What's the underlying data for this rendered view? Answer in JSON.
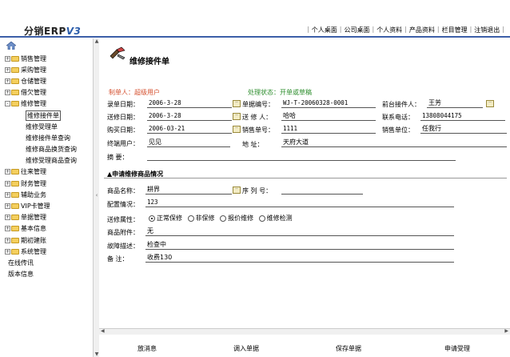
{
  "header": {
    "logo_text": "分销ERP",
    "logo_version": "V3",
    "nav": [
      "个人桌面",
      "公司桌面",
      "个人资料",
      "产品资料",
      "栏目管理",
      "注销退出"
    ]
  },
  "sidebar": {
    "items": [
      {
        "type": "folder",
        "label": "销售管理",
        "state": "+"
      },
      {
        "type": "folder",
        "label": "采购管理",
        "state": "+"
      },
      {
        "type": "folder",
        "label": "仓储管理",
        "state": "+"
      },
      {
        "type": "folder",
        "label": "借欠管理",
        "state": "+"
      },
      {
        "type": "folder",
        "label": "维修管理",
        "state": "-"
      },
      {
        "type": "child",
        "label": "维修接件单",
        "selected": true
      },
      {
        "type": "child",
        "label": "维修受理单"
      },
      {
        "type": "child",
        "label": "维修接件单查询"
      },
      {
        "type": "child",
        "label": "维修商品换货查询"
      },
      {
        "type": "child",
        "label": "维修受理商品查询"
      },
      {
        "type": "folder",
        "label": "往来管理",
        "state": "+"
      },
      {
        "type": "folder",
        "label": "财务管理",
        "state": "+"
      },
      {
        "type": "folder",
        "label": "辅助业务",
        "state": "+"
      },
      {
        "type": "folder",
        "label": "VIP卡管理",
        "state": "+"
      },
      {
        "type": "folder",
        "label": "单据管理",
        "state": "+"
      },
      {
        "type": "folder",
        "label": "基本信息",
        "state": "+"
      },
      {
        "type": "folder",
        "label": "期初建账",
        "state": "+"
      },
      {
        "type": "folder",
        "label": "系统管理",
        "state": "+"
      },
      {
        "type": "leaf",
        "label": "在线传讯"
      },
      {
        "type": "leaf",
        "label": "版本信息"
      }
    ]
  },
  "form": {
    "title": "维修接件单",
    "creator": "制单人：超级用户",
    "status": "处理状态：开单或草稿",
    "labels": {
      "record_date": "录单日期：",
      "bill_no": "单据编号：",
      "front_staff": "前台接件人：",
      "send_date": "送修日期：",
      "sender": "送 修 人：",
      "phone": "联系电话：",
      "buy_date": "购买日期：",
      "sales_no": "销售单号：",
      "sales_unit": "销售单位：",
      "end_user": "终端用户：",
      "address": "地    址：",
      "summary": "摘    要："
    },
    "values": {
      "record_date": "2006-3-28",
      "bill_no": "WJ-T-20060328-0001",
      "front_staff": "王芳",
      "send_date": "2006-3-28",
      "sender": "哈哈",
      "phone": "13808044175",
      "buy_date": "2006-03-21",
      "sales_no": "1111",
      "sales_unit": "任我行",
      "end_user": "见见",
      "address": "天府大道",
      "summary": ""
    },
    "section_title": "▲申请维修商品情况",
    "goods": {
      "labels": {
        "name": "商品名称：",
        "serial": "序 列 号：",
        "config": "配置情况：",
        "repair_type": "送修属性：",
        "accessory": "商品附件：",
        "fault": "故障描述：",
        "remark": "备    注："
      },
      "values": {
        "name": "耕界",
        "serial": "",
        "config": "123",
        "accessory": "无",
        "fault": "检查中",
        "remark": "收费130"
      },
      "repair_options": [
        {
          "label": "正常保修",
          "checked": true
        },
        {
          "label": "非保修",
          "checked": false
        },
        {
          "label": "报价维修",
          "checked": false
        },
        {
          "label": "维修检测",
          "checked": false
        }
      ]
    }
  },
  "buttons": {
    "cancel": "放消息",
    "import": "调入单据",
    "save": "保存单据",
    "apply": "申请受理"
  },
  "colors": {
    "accent": "#3d5fa8",
    "creator": "#d44f2e",
    "status": "#2b8c2b"
  }
}
